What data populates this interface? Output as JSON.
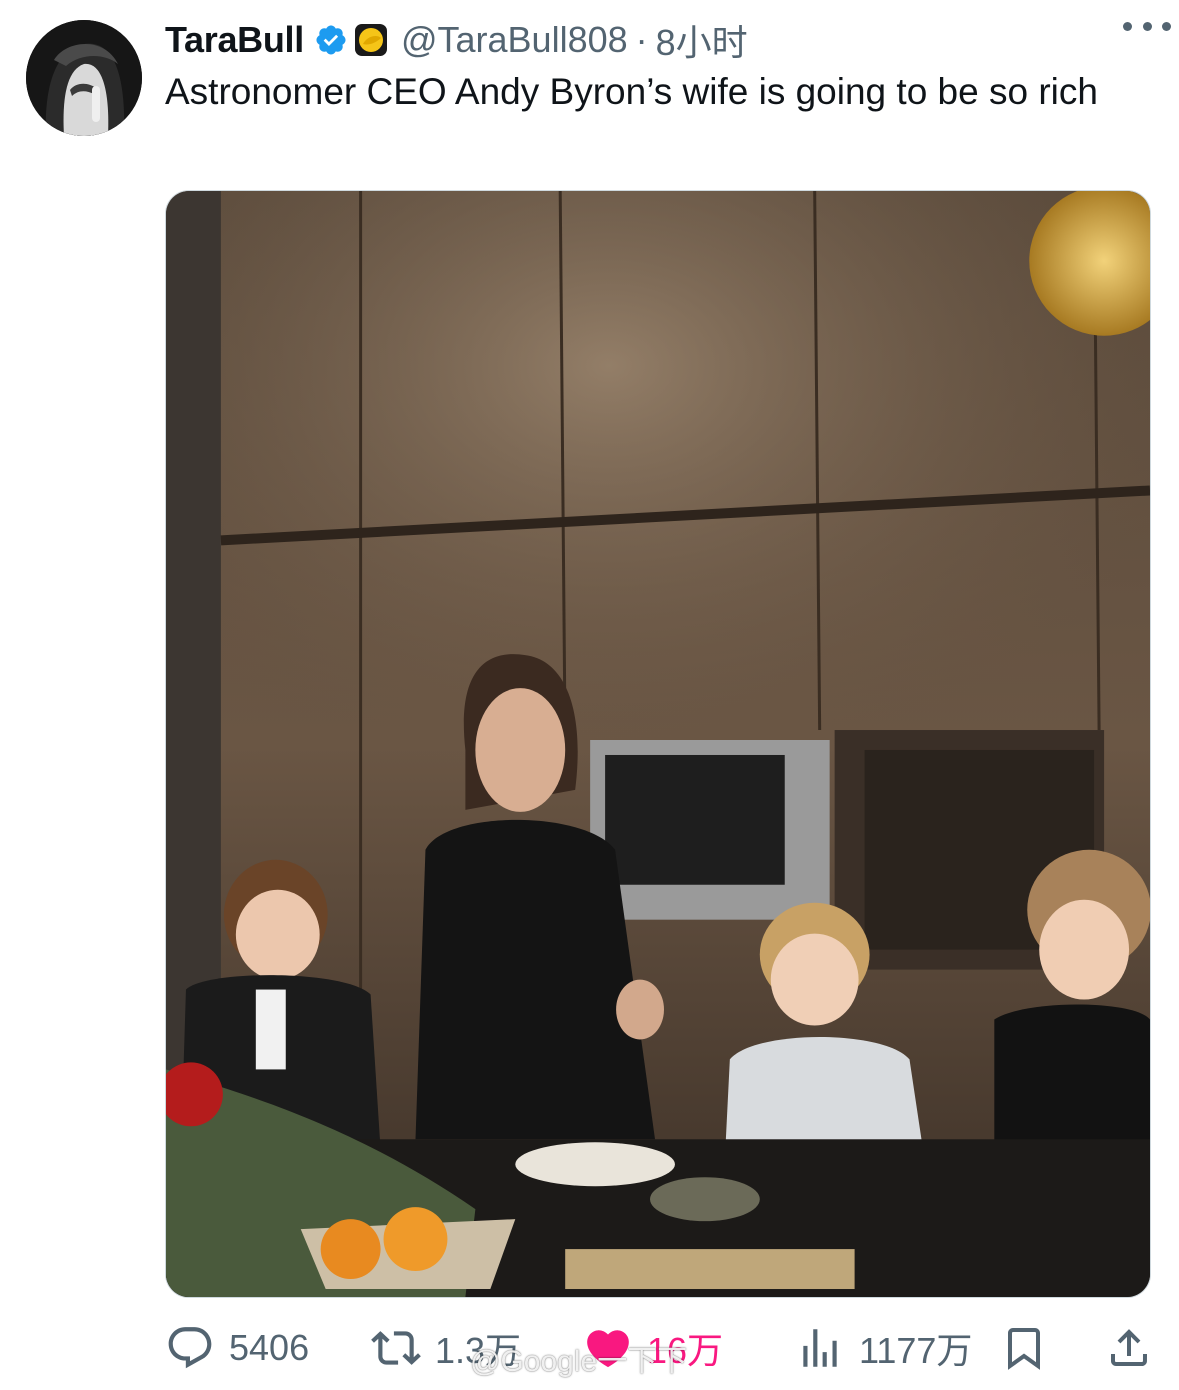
{
  "tweet": {
    "display_name": "TaraBull",
    "handle": "@TaraBull808",
    "separator": "·",
    "time": "8小时",
    "text": "Astronomer CEO Andy Byron’s wife is going to be so rich",
    "verified_icon": "verified-badge-icon",
    "affiliation_icon": "affiliate-badge-icon"
  },
  "actions": {
    "reply_count": "5406",
    "repost_count": "1.3万",
    "like_count": "16万",
    "view_count": "1177万"
  },
  "watermark": {
    "text": "@Google一下下"
  },
  "colors": {
    "text": "#0f1419",
    "secondary": "#536471",
    "verified": "#1d9bf0",
    "like": "#f91880"
  }
}
